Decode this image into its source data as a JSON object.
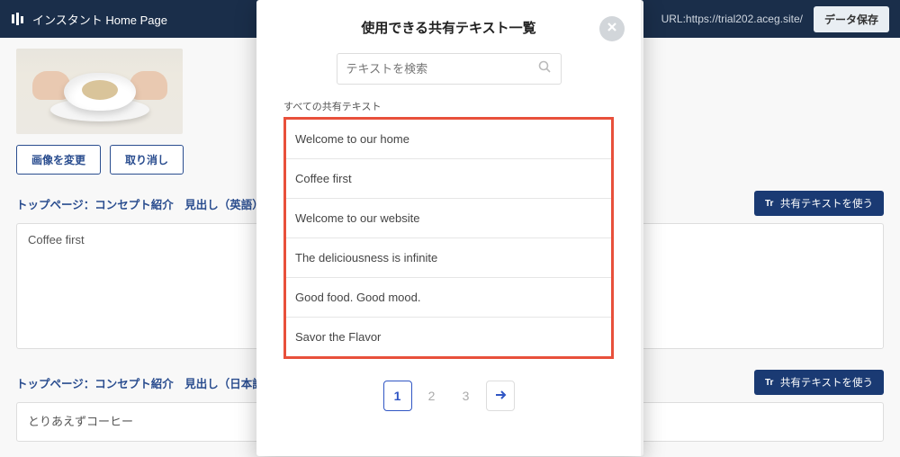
{
  "header": {
    "brand": "インスタント Home Page",
    "url_label": "URL:https://trial202.aceg.site/",
    "save_label": "データ保存"
  },
  "image_actions": {
    "change_label": "画像を変更",
    "cancel_label": "取り消し"
  },
  "sections": {
    "en": {
      "title": "トップページ：コンセプト紹介　見出し（英語）",
      "share_label": "共有テキストを使う",
      "value": "Coffee first"
    },
    "ja": {
      "title": "トップページ：コンセプト紹介　見出し（日本語）",
      "share_label": "共有テキストを使う",
      "value": "とりあえずコーヒー"
    }
  },
  "modal": {
    "title": "使用できる共有テキスト一覧",
    "search_placeholder": "テキストを検索",
    "all_label": "すべての共有テキスト",
    "items": [
      "Welcome to our home",
      "Coffee first",
      "Welcome to our website",
      "The deliciousness is infinite",
      "Good food. Good mood.",
      "Savor the Flavor"
    ],
    "pagination": {
      "pages": [
        "1",
        "2",
        "3"
      ],
      "current": 1
    }
  }
}
